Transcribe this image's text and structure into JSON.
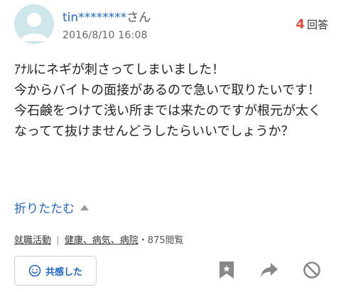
{
  "header": {
    "username": "tin********",
    "honorific": "さん",
    "date": "2016/8/10 16:08",
    "answer_count": "4",
    "answer_suffix": "回答"
  },
  "question": {
    "body": "ｱﾅﾙにネギが刺さってしまいました！\n今からバイトの面接があるので急いで取りたいです！\n今石鹸をつけて浅い所までは来たのですが根元が太くなってて抜けませんどうしたらいいでしょうか？"
  },
  "toggle": {
    "label": "折りたたむ"
  },
  "meta": {
    "category1": "就職活動",
    "separator": "|",
    "category2": "健康、病気、病院",
    "views": "・875閲覧"
  },
  "actions": {
    "empathy_label": "共感した",
    "icons": [
      "bookmark-icon",
      "share-arrow-icon",
      "block-icon"
    ]
  },
  "colors": {
    "link_blue": "#2167c9",
    "answer_red": "#e44a3b",
    "avatar_bg": "#cfe6ea",
    "icon_gray": "#888888"
  }
}
